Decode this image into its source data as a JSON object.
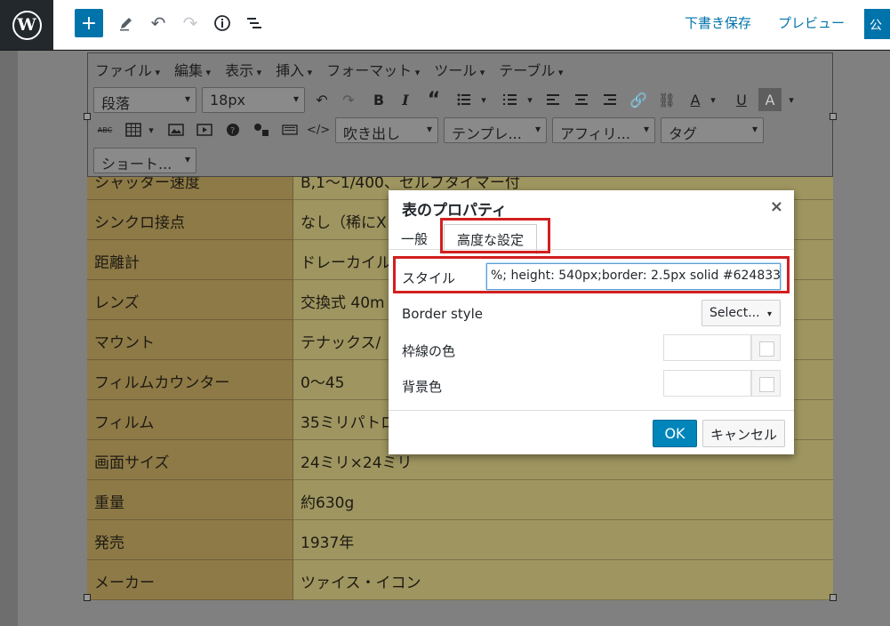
{
  "topbar": {
    "add_label": "+",
    "save_draft": "下書き保存",
    "preview": "プレビュー",
    "publish": "公"
  },
  "menubar": [
    "ファイル",
    "編集",
    "表示",
    "挿入",
    "フォーマット",
    "ツール",
    "テーブル"
  ],
  "toolbar": {
    "format_select": "段落",
    "size_select": "18px",
    "balloon": "吹き出し",
    "template": "テンプレ...",
    "affiliate": "アフィリ...",
    "tag": "タグ",
    "shortcode": "ショート..."
  },
  "table_rows": [
    {
      "label": "シャッター速度",
      "value": "B,1～1/400、セルフタイマー付"
    },
    {
      "label": "シンクロ接点",
      "value": "なし（稀にX"
    },
    {
      "label": "距離計",
      "value": "ドレーカイル"
    },
    {
      "label": "レンズ",
      "value": "交換式 40m"
    },
    {
      "label": "マウント",
      "value": "テナックス/"
    },
    {
      "label": "フィルムカウンター",
      "value": "0～45"
    },
    {
      "label": "フィルム",
      "value": "35ミリパトロ"
    },
    {
      "label": "画面サイズ",
      "value": "24ミリ×24ミリ"
    },
    {
      "label": "重量",
      "value": "約630g"
    },
    {
      "label": "発売",
      "value": "1937年"
    },
    {
      "label": "メーカー",
      "value": "ツァイス・イコン"
    }
  ],
  "dialog": {
    "title": "表のプロパティ",
    "close": "×",
    "tab_general": "一般",
    "tab_advanced": "高度な設定",
    "style_label": "スタイル",
    "style_value": "%; height: 540px;border: 2.5px solid #624833",
    "border_style_label": "Border style",
    "border_style_value": "Select...",
    "border_color_label": "枠線の色",
    "bg_color_label": "背景色",
    "ok": "OK",
    "cancel": "キャンセル"
  }
}
